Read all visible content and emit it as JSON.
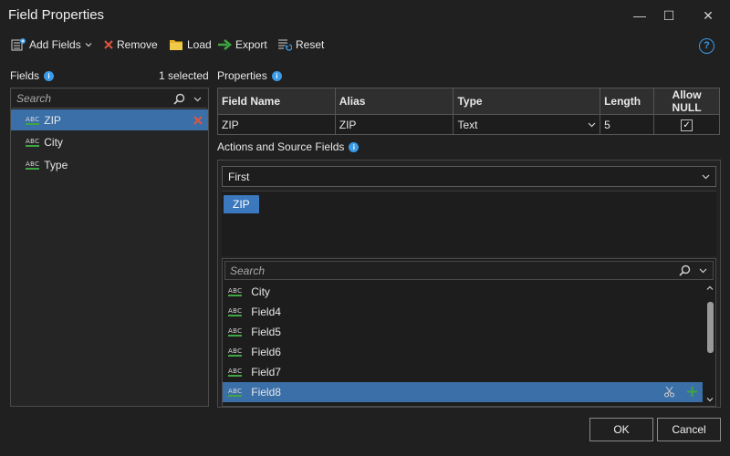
{
  "window": {
    "title": "Field Properties",
    "minimize_glyph": "—",
    "maximize_glyph": "☐",
    "close_glyph": "✕"
  },
  "toolbar": {
    "add_fields": "Add Fields",
    "remove": "Remove",
    "load": "Load",
    "export": "Export",
    "reset": "Reset",
    "help": "?"
  },
  "fields_panel": {
    "label": "Fields",
    "selected_count": "1 selected",
    "search_placeholder": "Search",
    "items": [
      {
        "name": "ZIP",
        "icon": "text-field-icon",
        "selected": true
      },
      {
        "name": "City",
        "icon": "text-field-icon",
        "selected": false
      },
      {
        "name": "Type",
        "icon": "text-field-icon",
        "selected": false
      }
    ]
  },
  "properties": {
    "label": "Properties",
    "columns": [
      "Field Name",
      "Alias",
      "Type",
      "Length",
      "Allow NULL"
    ],
    "row": {
      "field_name": "ZIP",
      "alias": "ZIP",
      "type": "Text",
      "length": "5",
      "allow_null": true
    }
  },
  "actions": {
    "label": "Actions and Source Fields",
    "action_selected": "First",
    "chips": [
      "ZIP"
    ],
    "search_placeholder": "Search",
    "source_fields": [
      {
        "name": "City",
        "selected": false
      },
      {
        "name": "Field4",
        "selected": false
      },
      {
        "name": "Field5",
        "selected": false
      },
      {
        "name": "Field6",
        "selected": false
      },
      {
        "name": "Field7",
        "selected": false
      },
      {
        "name": "Field8",
        "selected": true
      }
    ]
  },
  "footer": {
    "ok": "OK",
    "cancel": "Cancel"
  },
  "icon_text": {
    "abc": "ABC"
  },
  "colors": {
    "accent": "#3b78be",
    "selection": "#3a6fa8",
    "remove_red": "#e0533f",
    "add_green": "#3fa542"
  }
}
